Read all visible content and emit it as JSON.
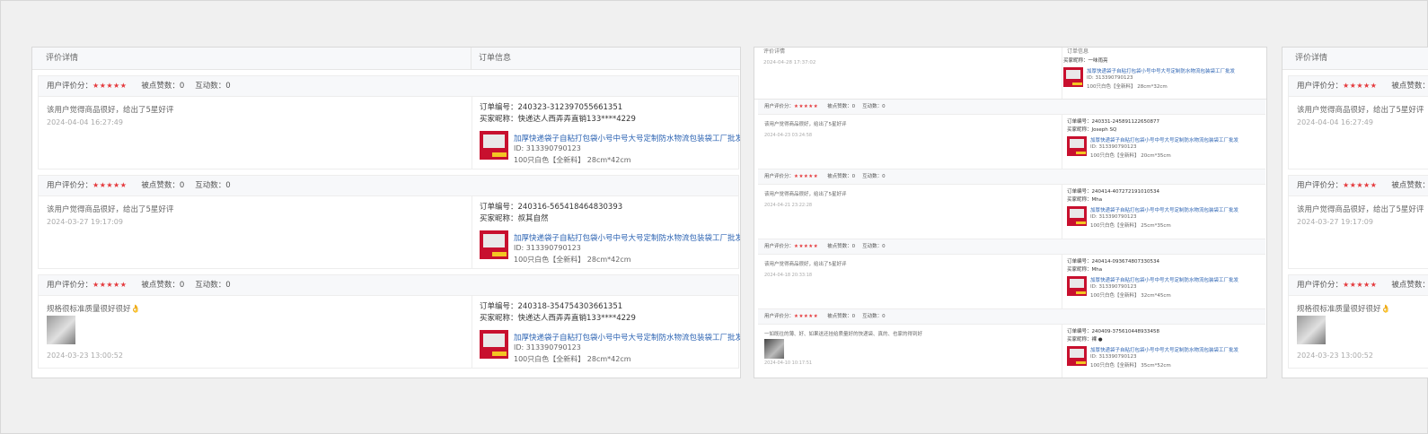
{
  "headers": {
    "review_col": "评价详情",
    "order_col": "订单信息"
  },
  "labels": {
    "user_rating": "用户评价分：",
    "stars": "★★★★★",
    "likes": "被点赞数：0",
    "interactions": "互动数：0",
    "order_no": "订单编号：",
    "buyer": "买家昵称：",
    "id_prefix": "ID: "
  },
  "product": {
    "title": "加厚快递袋子自粘打包袋小号中号大号定制防水物流包装袋工厂批发",
    "id": "313390790123"
  },
  "main_reviews": [
    {
      "text": "该用户觉得商品很好，给出了5星好评",
      "time": "2024-04-04 16:27:49",
      "has_image": false,
      "order_no": "240323-312397055661351",
      "buyer": "快递达人西弄弄直销133****4229",
      "spec": "100只白色【全新料】 28cm*42cm"
    },
    {
      "text": "该用户觉得商品很好，给出了5星好评",
      "time": "2024-03-27 19:17:09",
      "has_image": false,
      "order_no": "240316-565418464830393",
      "buyer": "叔其自然",
      "spec": "100只白色【全新料】 28cm*42cm"
    },
    {
      "text": "规格很标准质量很好很好👌",
      "time": "2024-03-23 13:00:52",
      "has_image": true,
      "order_no": "240318-354754303661351",
      "buyer": "快递达人西弄弄直销133****4229",
      "spec": "100只白色【全新料】 28cm*42cm"
    }
  ],
  "small_panel": {
    "header_review": "评价详情",
    "header_order": "订单信息",
    "top_time": "2024-04-28 17:37:02",
    "top_buyer": "买家昵称：一味雨亮",
    "top_spec": "100只白色【全新料】 28cm*32cm",
    "reviews": [
      {
        "text": "该用户觉得商品很好，给出了5星好评",
        "time": "2024-04-23 03:24:58",
        "has_image": false,
        "order_no": "240331-245891122650877",
        "buyer": "Joseph SQ",
        "spec": "100只白色【全新料】 20cm*35cm"
      },
      {
        "text": "该用户觉得商品很好，给出了5星好评",
        "time": "2024-04-21 23:22:28",
        "has_image": false,
        "order_no": "240414-407272191010534",
        "buyer": "Mha",
        "spec": "100只白色【全新料】 25cm*35cm"
      },
      {
        "text": "该用户觉得商品很好，给出了5星好评",
        "time": "2024-04-18 20:33:18",
        "has_image": false,
        "order_no": "240414-093674807330534",
        "buyer": "Mha",
        "spec": "100只白色【全新料】 32cm*45cm"
      },
      {
        "text": "一如既往的薄、好、如果送还挂给质量好的快递袋、真的、也家的得到好",
        "time": "2024-04-10 10:17:51",
        "has_image": true,
        "order_no": "240409-375610448933458",
        "buyer": "裸 ●",
        "spec": "100只白色【全新料】 35cm*52cm"
      }
    ]
  }
}
